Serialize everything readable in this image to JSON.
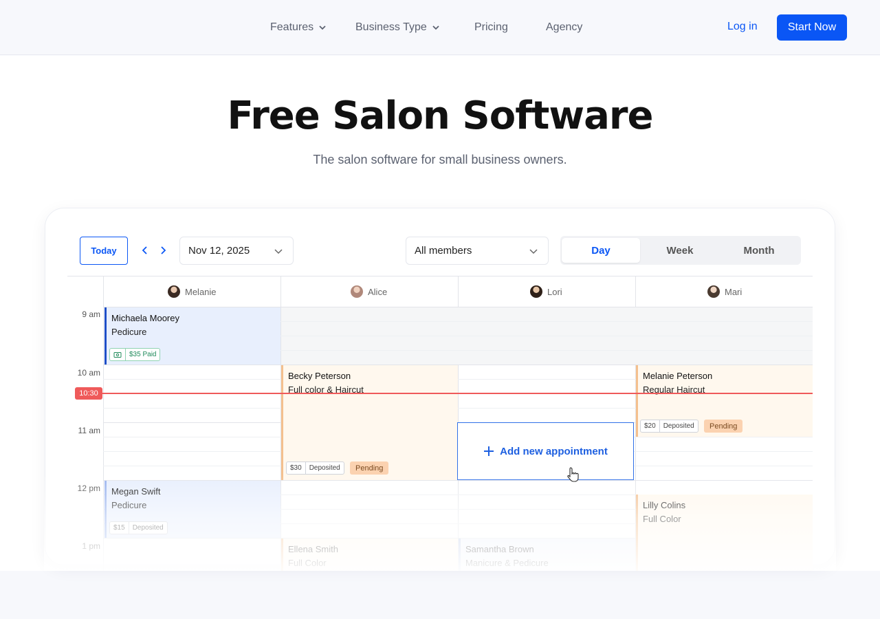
{
  "nav": {
    "items": [
      {
        "label": "Features",
        "has_dropdown": true
      },
      {
        "label": "Business Type",
        "has_dropdown": true
      },
      {
        "label": "Pricing",
        "has_dropdown": false
      },
      {
        "label": "Agency",
        "has_dropdown": false
      }
    ],
    "login_label": "Log in",
    "start_label": "Start Now"
  },
  "hero": {
    "title": "Free Salon Software",
    "subtitle": "The salon software for small business owners."
  },
  "calendar": {
    "today_label": "Today",
    "date_value": "Nov 12, 2025",
    "members_value": "All members",
    "views": [
      "Day",
      "Week",
      "Month"
    ],
    "active_view": "Day",
    "members": [
      "Melanie",
      "Alice",
      "Lori",
      "Mari"
    ],
    "times": [
      "9 am",
      "10 am",
      "11 am",
      "12 pm",
      "1 pm"
    ],
    "now_label": "10:30",
    "add_label": "Add new appointment",
    "appointments": [
      {
        "name": "Michaela Moorey",
        "service": "Pedicure",
        "price": "$35",
        "status": "Paid",
        "color": "#e8effd",
        "accent": "#1f4fc7"
      },
      {
        "name": "Becky Peterson",
        "service": "Full color & Haircut",
        "price": "$30",
        "status": "Deposited",
        "badge": "Pending",
        "color": "#fff8ee",
        "accent": "#f4c08e"
      },
      {
        "name": "Melanie Peterson",
        "service": "Regular Haircut",
        "price": "$20",
        "status": "Deposited",
        "badge": "Pending",
        "color": "#fff8ee",
        "accent": "#f4c08e"
      },
      {
        "name": "Megan Swift",
        "service": "Pedicure",
        "price": "$15",
        "status": "Deposited",
        "color": "#e8effd",
        "accent": "#9db6ee"
      },
      {
        "name": "Lilly Colins",
        "service": "Full Color",
        "color": "#fff8ee",
        "accent": "#f4c08e"
      },
      {
        "name": "Ellena Smith",
        "service": "Full Color",
        "color": "#fff8ee",
        "accent": "#f4c08e"
      },
      {
        "name": "Samantha Brown",
        "service": "Manicure & Pedicure",
        "color": "#eef2fb",
        "accent": "#b9c7e6"
      }
    ]
  },
  "colors": {
    "accent": "#0a56f5",
    "now": "#ef5a5a",
    "pending": "#fbd2b0"
  }
}
